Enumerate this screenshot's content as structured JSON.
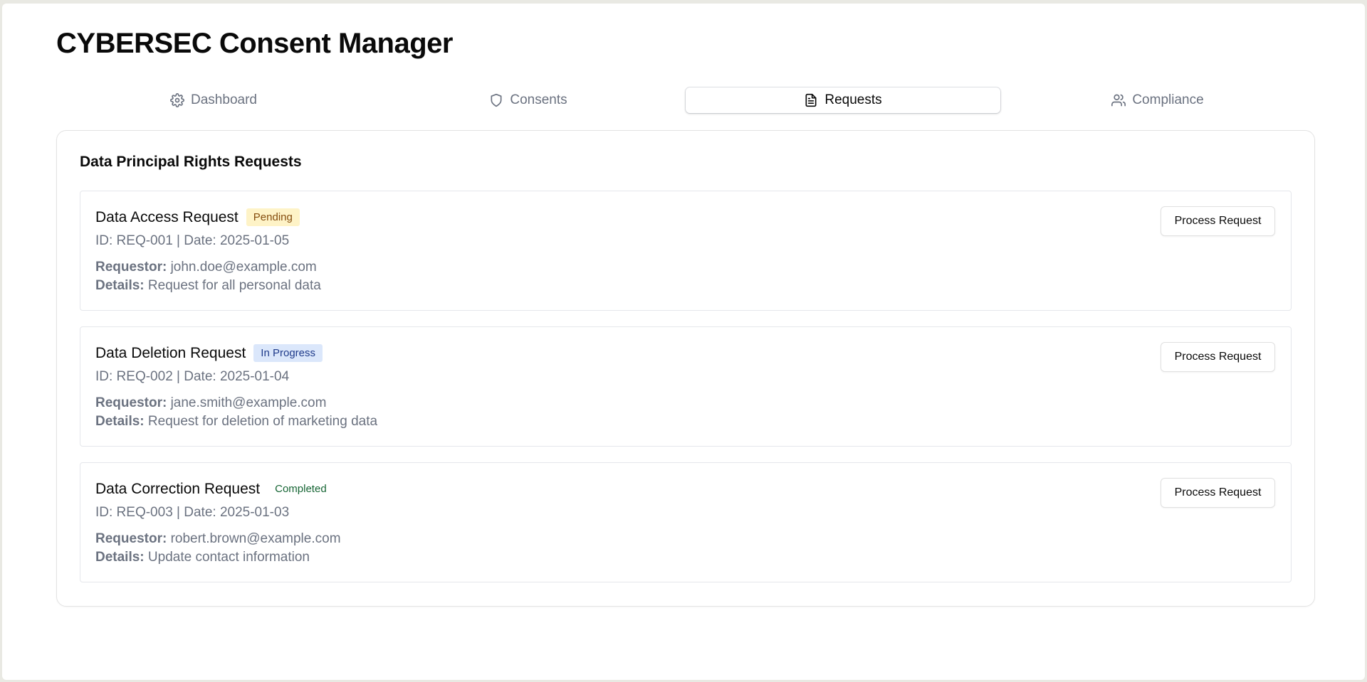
{
  "app": {
    "title": "CYBERSEC Consent Manager"
  },
  "tabs": [
    {
      "label": "Dashboard",
      "icon": "gear-icon",
      "active": false
    },
    {
      "label": "Consents",
      "icon": "shield-icon",
      "active": false
    },
    {
      "label": "Requests",
      "icon": "document-icon",
      "active": true
    },
    {
      "label": "Compliance",
      "icon": "users-icon",
      "active": false
    }
  ],
  "panel": {
    "title": "Data Principal Rights Requests",
    "requestor_label": "Requestor:",
    "details_label": "Details:",
    "requests": [
      {
        "title": "Data Access Request",
        "status": "Pending",
        "meta": "ID: REQ-001 | Date: 2025-01-05",
        "requestor": "john.doe@example.com",
        "details": "Request for all personal data",
        "action": "Process Request"
      },
      {
        "title": "Data Deletion Request",
        "status": "In Progress",
        "meta": "ID: REQ-002 | Date: 2025-01-04",
        "requestor": "jane.smith@example.com",
        "details": "Request for deletion of marketing data",
        "action": "Process Request"
      },
      {
        "title": "Data Correction Request",
        "status": "Completed",
        "meta": "ID: REQ-003 | Date: 2025-01-03",
        "requestor": "robert.brown@example.com",
        "details": "Update contact information",
        "action": "Process Request"
      }
    ]
  },
  "colors": {
    "pending_bg": "#fef3c7",
    "pending_fg": "#854d0e",
    "progress_bg": "#dbe7fb",
    "progress_fg": "#1e3a8a",
    "completed_fg": "#166534"
  }
}
